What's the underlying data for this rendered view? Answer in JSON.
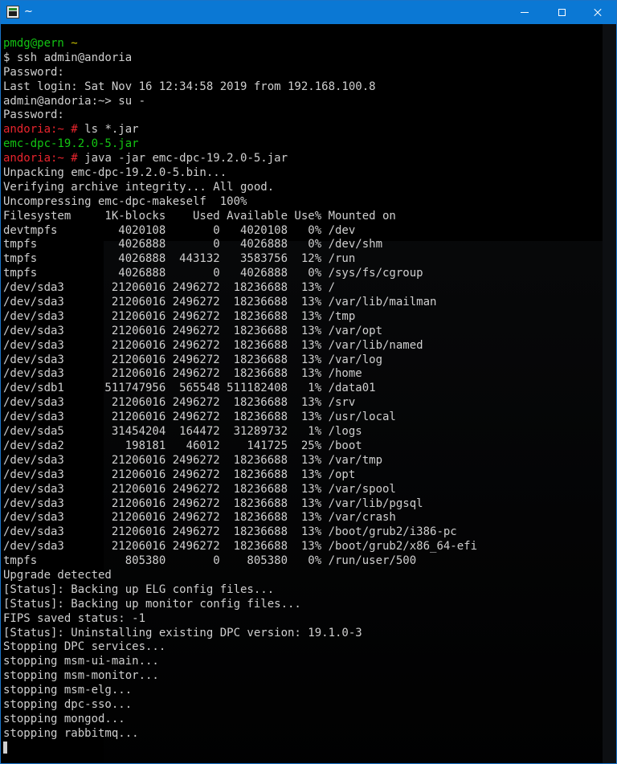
{
  "window": {
    "title": "~",
    "app_icon": "terminal-app-icon",
    "controls": [
      "minimize-icon",
      "maximize-icon",
      "close-icon"
    ],
    "accent_color": "#0b78d4"
  },
  "terminal": {
    "prompt_colors": {
      "user_host": "#13c413",
      "tilde": "#c8c000",
      "root_prompt": "#e8242d",
      "jar_file": "#13c413",
      "text": "#cfcfcf"
    },
    "lines": [
      [
        {
          "t": "pmdg@pern ",
          "c": "green"
        },
        {
          "t": "~",
          "c": "yellow"
        }
      ],
      [
        {
          "t": "$ ssh admin@andoria",
          "c": "default"
        }
      ],
      [
        {
          "t": "Password:",
          "c": "default"
        }
      ],
      [
        {
          "t": "Last login: Sat Nov 16 12:34:58 2019 from 192.168.100.8",
          "c": "default"
        }
      ],
      [
        {
          "t": "admin@andoria:~> su -",
          "c": "default"
        }
      ],
      [
        {
          "t": "Password:",
          "c": "default"
        }
      ],
      [
        {
          "t": "andoria:~ # ",
          "c": "red"
        },
        {
          "t": "ls *.jar",
          "c": "default"
        }
      ],
      [
        {
          "t": "emc-dpc-19.2.0-5.jar",
          "c": "green"
        }
      ],
      [
        {
          "t": "andoria:~ # ",
          "c": "red"
        },
        {
          "t": "java -jar emc-dpc-19.2.0-5.jar",
          "c": "default"
        }
      ],
      [
        {
          "t": "Unpacking emc-dpc-19.2.0-5.bin...",
          "c": "default"
        }
      ],
      [
        {
          "t": "Verifying archive integrity... All good.",
          "c": "default"
        }
      ],
      [
        {
          "t": "Uncompressing emc-dpc-makeself  100%",
          "c": "default"
        }
      ],
      [
        {
          "t": "Filesystem     1K-blocks    Used Available Use% Mounted on",
          "c": "default"
        }
      ],
      [
        {
          "t": "devtmpfs         4020108       0   4020108   0% /dev",
          "c": "default"
        }
      ],
      [
        {
          "t": "tmpfs            4026888       0   4026888   0% /dev/shm",
          "c": "default"
        }
      ],
      [
        {
          "t": "tmpfs            4026888  443132   3583756  12% /run",
          "c": "default"
        }
      ],
      [
        {
          "t": "tmpfs            4026888       0   4026888   0% /sys/fs/cgroup",
          "c": "default"
        }
      ],
      [
        {
          "t": "/dev/sda3       21206016 2496272  18236688  13% /",
          "c": "default"
        }
      ],
      [
        {
          "t": "/dev/sda3       21206016 2496272  18236688  13% /var/lib/mailman",
          "c": "default"
        }
      ],
      [
        {
          "t": "/dev/sda3       21206016 2496272  18236688  13% /tmp",
          "c": "default"
        }
      ],
      [
        {
          "t": "/dev/sda3       21206016 2496272  18236688  13% /var/opt",
          "c": "default"
        }
      ],
      [
        {
          "t": "/dev/sda3       21206016 2496272  18236688  13% /var/lib/named",
          "c": "default"
        }
      ],
      [
        {
          "t": "/dev/sda3       21206016 2496272  18236688  13% /var/log",
          "c": "default"
        }
      ],
      [
        {
          "t": "/dev/sda3       21206016 2496272  18236688  13% /home",
          "c": "default"
        }
      ],
      [
        {
          "t": "/dev/sdb1      511747956  565548 511182408   1% /data01",
          "c": "default"
        }
      ],
      [
        {
          "t": "/dev/sda3       21206016 2496272  18236688  13% /srv",
          "c": "default"
        }
      ],
      [
        {
          "t": "/dev/sda3       21206016 2496272  18236688  13% /usr/local",
          "c": "default"
        }
      ],
      [
        {
          "t": "/dev/sda5       31454204  164472  31289732   1% /logs",
          "c": "default"
        }
      ],
      [
        {
          "t": "/dev/sda2         198181   46012    141725  25% /boot",
          "c": "default"
        }
      ],
      [
        {
          "t": "/dev/sda3       21206016 2496272  18236688  13% /var/tmp",
          "c": "default"
        }
      ],
      [
        {
          "t": "/dev/sda3       21206016 2496272  18236688  13% /opt",
          "c": "default"
        }
      ],
      [
        {
          "t": "/dev/sda3       21206016 2496272  18236688  13% /var/spool",
          "c": "default"
        }
      ],
      [
        {
          "t": "/dev/sda3       21206016 2496272  18236688  13% /var/lib/pgsql",
          "c": "default"
        }
      ],
      [
        {
          "t": "/dev/sda3       21206016 2496272  18236688  13% /var/crash",
          "c": "default"
        }
      ],
      [
        {
          "t": "/dev/sda3       21206016 2496272  18236688  13% /boot/grub2/i386-pc",
          "c": "default"
        }
      ],
      [
        {
          "t": "/dev/sda3       21206016 2496272  18236688  13% /boot/grub2/x86_64-efi",
          "c": "default"
        }
      ],
      [
        {
          "t": "tmpfs             805380       0    805380   0% /run/user/500",
          "c": "default"
        }
      ],
      [
        {
          "t": "Upgrade detected",
          "c": "default"
        }
      ],
      [
        {
          "t": "[Status]: Backing up ELG config files...",
          "c": "default"
        }
      ],
      [
        {
          "t": "[Status]: Backing up monitor config files...",
          "c": "default"
        }
      ],
      [
        {
          "t": "FIPS saved status: -1",
          "c": "default"
        }
      ],
      [
        {
          "t": "[Status]: Uninstalling existing DPC version: 19.1.0-3",
          "c": "default"
        }
      ],
      [
        {
          "t": "Stopping DPC services...",
          "c": "default"
        }
      ],
      [
        {
          "t": "stopping msm-ui-main...",
          "c": "default"
        }
      ],
      [
        {
          "t": "stopping msm-monitor...",
          "c": "default"
        }
      ],
      [
        {
          "t": "stopping msm-elg...",
          "c": "default"
        }
      ],
      [
        {
          "t": "stopping dpc-sso...",
          "c": "default"
        }
      ],
      [
        {
          "t": "stopping mongod...",
          "c": "default"
        }
      ],
      [
        {
          "t": "stopping rabbitmq...",
          "c": "default"
        }
      ]
    ],
    "cursor": "block-cursor"
  }
}
